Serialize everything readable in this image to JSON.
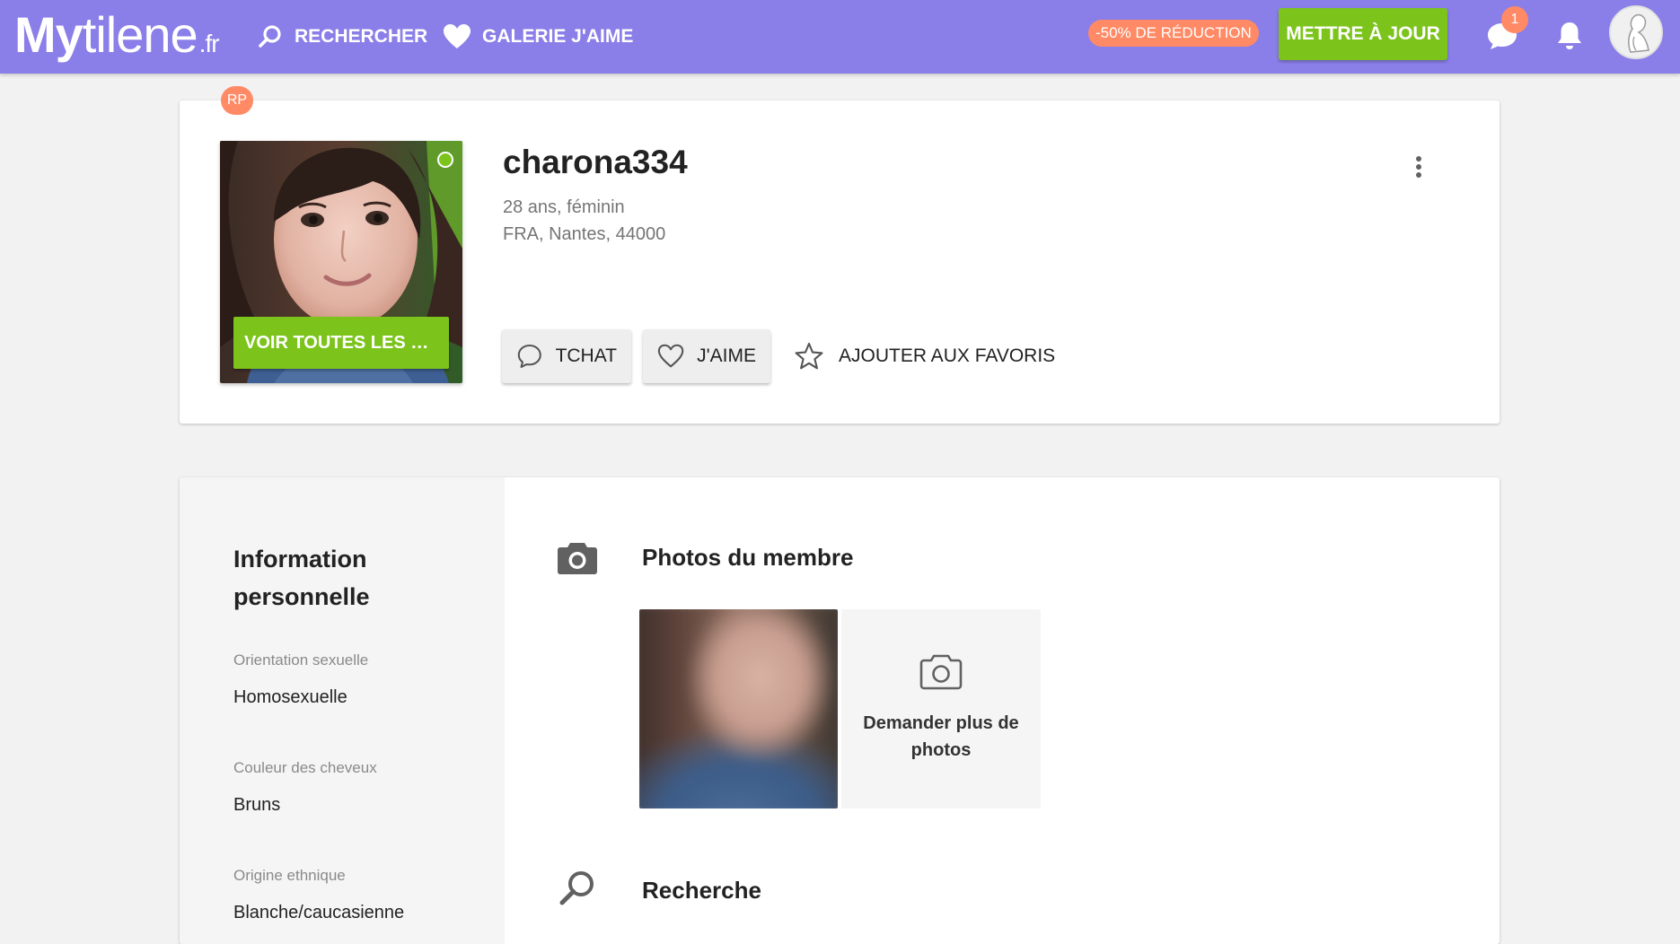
{
  "header": {
    "logo": {
      "part1": "My",
      "part2": "tilene",
      "tld": ".fr"
    },
    "nav": [
      {
        "label": "RECHERCHER",
        "icon": "search-icon"
      },
      {
        "label": "GALERIE J'AIME",
        "icon": "heart-icon"
      }
    ],
    "discount_badge": "-50% DE RÉDUCTION",
    "upgrade_button": "METTRE À JOUR",
    "message_count": "1",
    "colors": {
      "bar": "#8a7ee8",
      "accent_green": "#7cc41c",
      "accent_orange": "#ff8a65"
    }
  },
  "profile": {
    "badge": "RP",
    "username": "charona334",
    "age_gender": "28 ans, féminin",
    "location": "FRA, Nantes, 44000",
    "see_photos_button": "VOIR TOUTES LES PHOTOS",
    "online": true,
    "actions": {
      "chat": "TCHAT",
      "like": "J'AIME",
      "favorite": "AJOUTER AUX FAVORIS"
    }
  },
  "details": {
    "info_title": "Information personnelle",
    "fields": [
      {
        "label": "Orientation sexuelle",
        "value": "Homosexuelle"
      },
      {
        "label": "Couleur des cheveux",
        "value": "Bruns"
      },
      {
        "label": "Origine ethnique",
        "value": "Blanche/caucasienne"
      }
    ],
    "photos_section": {
      "title": "Photos du membre",
      "request_label": "Demander plus de photos"
    },
    "search_section": {
      "title": "Recherche"
    }
  }
}
